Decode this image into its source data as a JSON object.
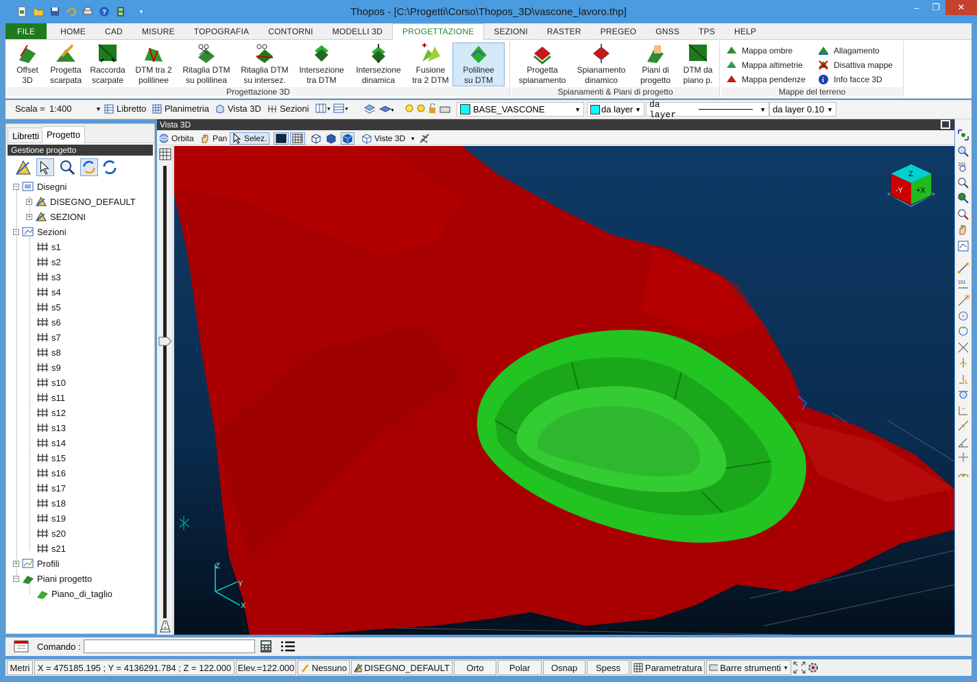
{
  "window": {
    "title": "Thopos - [C:\\Progetti\\Corso\\Thopos_3D\\vascone_lavoro.thp]"
  },
  "menu": {
    "tabs": [
      "FILE",
      "HOME",
      "CAD",
      "MISURE",
      "TOPOGRAFIA",
      "CONTORNI",
      "MODELLI 3D",
      "PROGETTAZIONE",
      "SEZIONI",
      "RASTER",
      "PREGEO",
      "GNSS",
      "TPS",
      "HELP"
    ],
    "active": "PROGETTAZIONE"
  },
  "ribbon": {
    "group1": {
      "label": "Progettazione 3D",
      "buttons": [
        {
          "line1": "Offset",
          "line2": "3D"
        },
        {
          "line1": "Progetta",
          "line2": "scarpata"
        },
        {
          "line1": "Raccorda",
          "line2": "scarpate"
        },
        {
          "line1": "DTM tra 2",
          "line2": "polilinee"
        },
        {
          "line1": "Ritaglia DTM",
          "line2": "su polilinea"
        },
        {
          "line1": "Ritaglia DTM",
          "line2": "su intersez."
        },
        {
          "line1": "Intersezione",
          "line2": "tra DTM"
        },
        {
          "line1": "Intersezione",
          "line2": "dinamica"
        },
        {
          "line1": "Fusione",
          "line2": "tra 2 DTM"
        },
        {
          "line1": "Polilinee",
          "line2": "su DTM"
        }
      ]
    },
    "group2": {
      "label": "Spianamenti & Piani di progetto",
      "buttons": [
        {
          "line1": "Progetta",
          "line2": "spianamento"
        },
        {
          "line1": "Spianamento",
          "line2": "dinamico"
        },
        {
          "line1": "Piani di",
          "line2": "progetto"
        },
        {
          "line1": "DTM da",
          "line2": "piano p."
        }
      ]
    },
    "group3": {
      "label": "Mappe del terreno",
      "items": [
        "Mappa ombre",
        "Mappa altimetrie",
        "Mappa pendenze",
        "Allagamento",
        "Disattiva mappe",
        "Info facce 3D"
      ]
    }
  },
  "toolbar": {
    "scale_label": "Scala =",
    "scale_value": "1:400",
    "libretto": "Libretto",
    "planimetria": "Planimetria",
    "vista3d": "Vista 3D",
    "sezioni": "Sezioni",
    "layer": "BASE_VASCONE",
    "layer_color": "#00ffff",
    "color_mode": "da layer",
    "linetype": "da layer",
    "lineweight": "da layer 0.10"
  },
  "leftpanel": {
    "tabs": [
      "Libretti",
      "Progetto"
    ],
    "active_tab": "Progetto",
    "header": "Gestione progetto",
    "tree": {
      "disegni": "Disegni",
      "disegni_children": [
        "DISEGNO_DEFAULT",
        "SEZIONI"
      ],
      "sezioni": "Sezioni",
      "sezioni_children": [
        "s1",
        "s2",
        "s3",
        "s4",
        "s5",
        "s6",
        "s7",
        "s8",
        "s9",
        "s10",
        "s11",
        "s12",
        "s13",
        "s14",
        "s15",
        "s16",
        "s17",
        "s18",
        "s19",
        "s20",
        "s21"
      ],
      "profili": "Profili",
      "piani": "Piani progetto",
      "piani_children": [
        "Piano_di_taglio"
      ]
    }
  },
  "view3d": {
    "title": "Vista 3D",
    "orbita": "Orbita",
    "pan": "Pan",
    "selez": "Selez.",
    "viste3d": "Viste 3D",
    "cube_labels": {
      "z": "Z",
      "y": "-Y",
      "x": "+X"
    },
    "axis_labels": {
      "z": "Z",
      "y": "Y",
      "x": "X"
    }
  },
  "command": {
    "label": "Comando :",
    "value": ""
  },
  "statusbar": {
    "units": "Metri",
    "coords": "X = 475185.195 ; Y = 4136291.784 ; Z = 122.000",
    "elev": "Elev.=122.000",
    "snap": "Nessuno",
    "drawing": "DISEGNO_DEFAULT",
    "orto": "Orto",
    "polar": "Polar",
    "osnap": "Osnap",
    "spess": "Spess",
    "param": "Parametratura",
    "barre": "Barre strumenti"
  }
}
